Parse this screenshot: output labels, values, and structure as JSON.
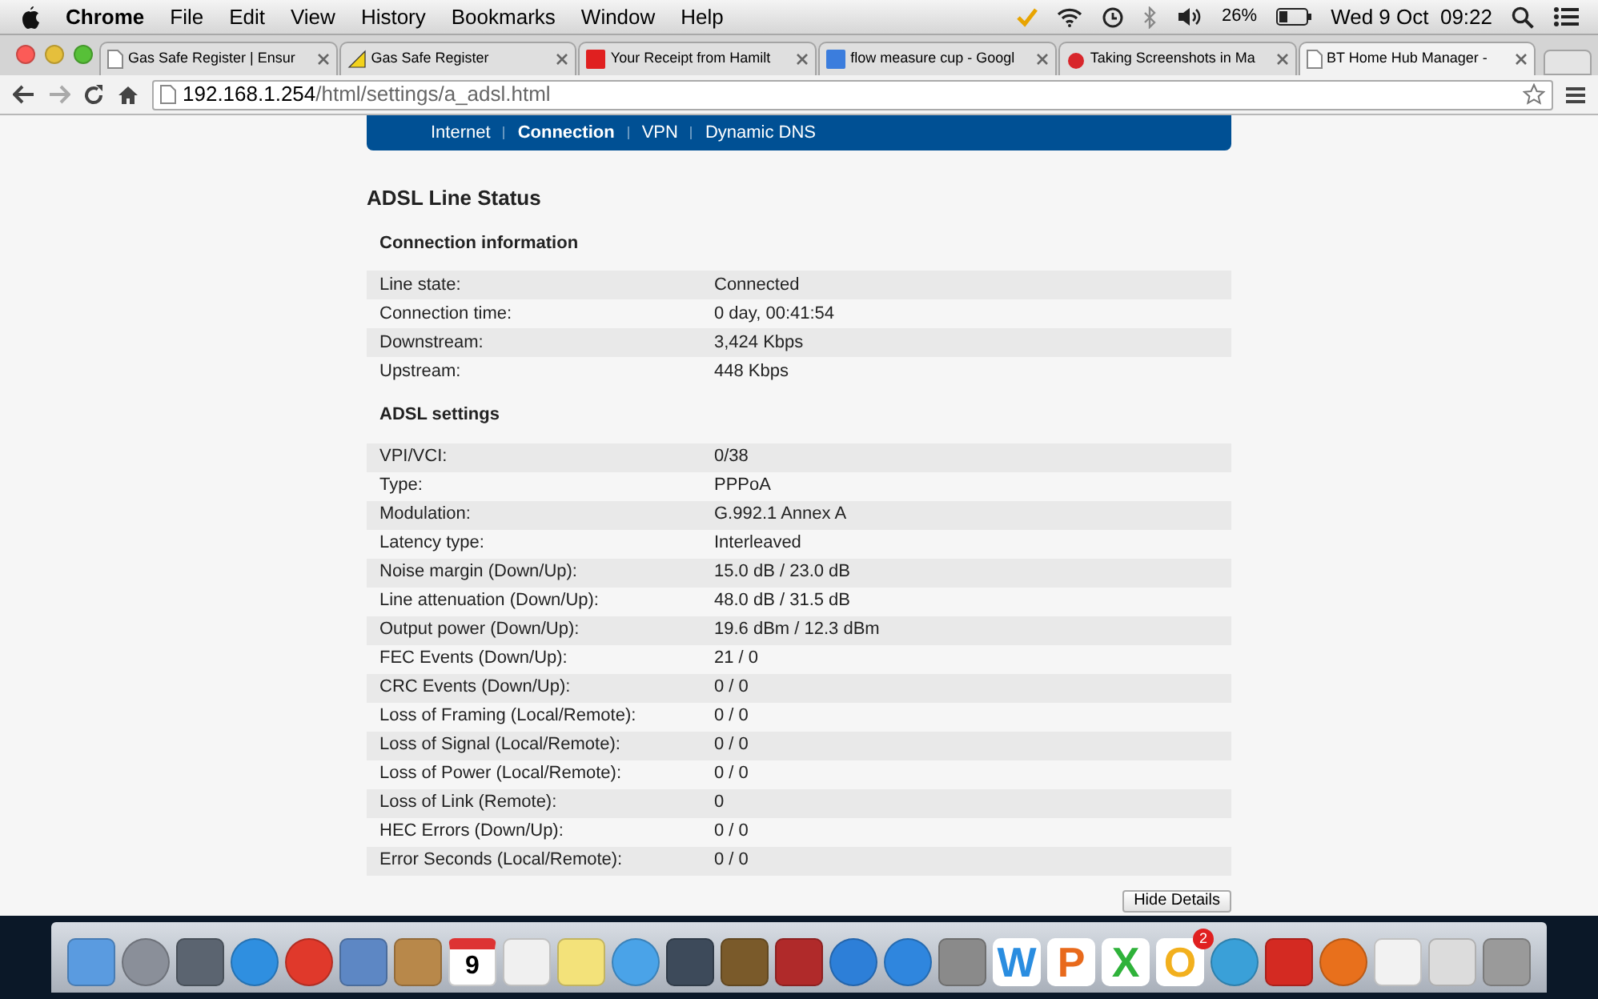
{
  "menu_bar": {
    "app": "Chrome",
    "items": [
      "File",
      "Edit",
      "View",
      "History",
      "Bookmarks",
      "Window",
      "Help"
    ],
    "battery_percent": "26%",
    "clock": "Wed 9 Oct  09:22"
  },
  "tabs": [
    {
      "title": "Gas Safe Register | Ensur",
      "selected": false
    },
    {
      "title": "Gas Safe Register",
      "selected": false
    },
    {
      "title": "Your Receipt from Hamilt",
      "selected": false
    },
    {
      "title": "flow measure cup - Googl",
      "selected": false
    },
    {
      "title": "Taking Screenshots in Ma",
      "selected": false
    },
    {
      "title": "BT Home Hub Manager -",
      "selected": true
    }
  ],
  "address_bar": {
    "host": "192.168.1.254",
    "path": "/html/settings/a_adsl.html"
  },
  "nav": [
    {
      "label": "Internet",
      "selected": false
    },
    {
      "label": "Connection",
      "selected": true
    },
    {
      "label": "VPN",
      "selected": false
    },
    {
      "label": "Dynamic DNS",
      "selected": false
    }
  ],
  "page_title": "ADSL Line Status",
  "sections": [
    {
      "title": "Connection information",
      "rows": [
        [
          "Line state:",
          "Connected"
        ],
        [
          "Connection time:",
          "0 day, 00:41:54"
        ],
        [
          "Downstream:",
          "3,424 Kbps"
        ],
        [
          "Upstream:",
          "448 Kbps"
        ]
      ]
    },
    {
      "title": "ADSL settings",
      "rows": [
        [
          "VPI/VCI:",
          "0/38"
        ],
        [
          "Type:",
          "PPPoA"
        ],
        [
          "Modulation:",
          "G.992.1 Annex A"
        ],
        [
          "Latency type:",
          "Interleaved"
        ],
        [
          "Noise margin (Down/Up):",
          "15.0 dB / 23.0 dB"
        ],
        [
          "Line attenuation (Down/Up):",
          "48.0 dB / 31.5 dB"
        ],
        [
          "Output power (Down/Up):",
          "19.6 dBm / 12.3 dBm"
        ],
        [
          "FEC Events (Down/Up):",
          "21 / 0"
        ],
        [
          "CRC Events (Down/Up):",
          "0 / 0"
        ],
        [
          "Loss of Framing (Local/Remote):",
          "0 / 0"
        ],
        [
          "Loss of Signal (Local/Remote):",
          "0 / 0"
        ],
        [
          "Loss of Power (Local/Remote):",
          "0 / 0"
        ],
        [
          "Loss of Link (Remote):",
          "0"
        ],
        [
          "HEC Errors (Down/Up):",
          "0 / 0"
        ],
        [
          "Error Seconds (Local/Remote):",
          "0 / 0"
        ]
      ]
    }
  ],
  "hide_button": "Hide Details",
  "dock": [
    {
      "kind": "square",
      "color": "#5a9be0"
    },
    {
      "kind": "circle",
      "color": "#8a8f99"
    },
    {
      "kind": "square",
      "color": "#5b6470"
    },
    {
      "kind": "circle",
      "color": "#2f8fe0"
    },
    {
      "kind": "circle",
      "color": "#e0392b"
    },
    {
      "kind": "square",
      "color": "#5d87c4"
    },
    {
      "kind": "square",
      "color": "#b8884a"
    },
    {
      "kind": "calendar",
      "color": "#ffffff",
      "day": "9"
    },
    {
      "kind": "square",
      "color": "#f0f0f0"
    },
    {
      "kind": "square",
      "color": "#f3e27a"
    },
    {
      "kind": "circle",
      "color": "#4aa3e8"
    },
    {
      "kind": "square",
      "color": "#3d4a5a"
    },
    {
      "kind": "square",
      "color": "#7a5a2a"
    },
    {
      "kind": "square",
      "color": "#b02a2a"
    },
    {
      "kind": "circle",
      "color": "#2d7fd8"
    },
    {
      "kind": "circle",
      "color": "#2f86de"
    },
    {
      "kind": "square",
      "color": "#8a8a8a"
    },
    {
      "kind": "letter",
      "color": "#2a8de0",
      "letter": "W"
    },
    {
      "kind": "letter",
      "color": "#e86a1c",
      "letter": "P"
    },
    {
      "kind": "letter",
      "color": "#2fb23a",
      "letter": "X"
    },
    {
      "kind": "letter",
      "color": "#f2b01e",
      "letter": "O",
      "badge": "2"
    },
    {
      "kind": "circle",
      "color": "#3aa0d8"
    },
    {
      "kind": "square",
      "color": "#d42a22"
    },
    {
      "kind": "circle",
      "color": "#e8701c"
    },
    {
      "kind": "square",
      "color": "#f2f2f2"
    },
    {
      "kind": "square",
      "color": "#dcdcdc"
    },
    {
      "kind": "square",
      "color": "#9a9a9a"
    }
  ]
}
